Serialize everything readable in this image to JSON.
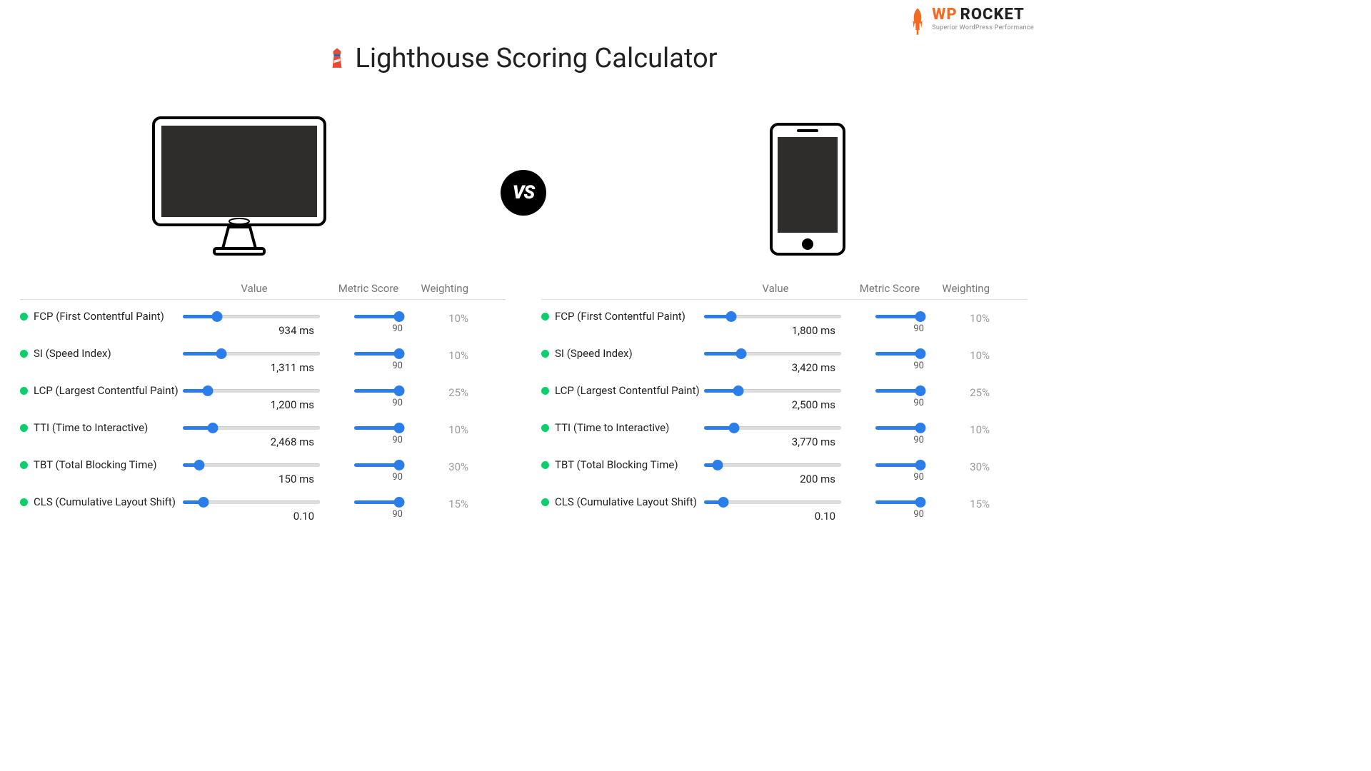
{
  "brand": {
    "wp": "WP",
    "rocket": "ROCKET",
    "tagline": "Superior WordPress Performance"
  },
  "title": "Lighthouse Scoring Calculator",
  "vs": "VS",
  "columns": {
    "value": "Value",
    "metric_score": "Metric Score",
    "weighting": "Weighting"
  },
  "desktop": {
    "metrics": [
      {
        "label": "FCP (First Contentful Paint)",
        "value_text": "934 ms",
        "value_pos": 25,
        "score": "90",
        "score_pos": 90,
        "weight": "10%"
      },
      {
        "label": "SI (Speed Index)",
        "value_text": "1,311 ms",
        "value_pos": 28,
        "score": "90",
        "score_pos": 90,
        "weight": "10%"
      },
      {
        "label": "LCP (Largest Contentful Paint)",
        "value_text": "1,200 ms",
        "value_pos": 18,
        "score": "90",
        "score_pos": 90,
        "weight": "25%"
      },
      {
        "label": "TTI (Time to Interactive)",
        "value_text": "2,468 ms",
        "value_pos": 22,
        "score": "90",
        "score_pos": 90,
        "weight": "10%"
      },
      {
        "label": "TBT (Total Blocking Time)",
        "value_text": "150 ms",
        "value_pos": 12,
        "score": "90",
        "score_pos": 90,
        "weight": "30%"
      },
      {
        "label": "CLS (Cumulative Layout Shift)",
        "value_text": "0.10",
        "value_pos": 15,
        "score": "90",
        "score_pos": 90,
        "weight": "15%"
      }
    ]
  },
  "mobile": {
    "metrics": [
      {
        "label": "FCP (First Contentful Paint)",
        "value_text": "1,800 ms",
        "value_pos": 20,
        "score": "90",
        "score_pos": 90,
        "weight": "10%"
      },
      {
        "label": "SI (Speed Index)",
        "value_text": "3,420 ms",
        "value_pos": 27,
        "score": "90",
        "score_pos": 90,
        "weight": "10%"
      },
      {
        "label": "LCP (Largest Contentful Paint)",
        "value_text": "2,500 ms",
        "value_pos": 25,
        "score": "90",
        "score_pos": 90,
        "weight": "25%"
      },
      {
        "label": "TTI (Time to Interactive)",
        "value_text": "3,770 ms",
        "value_pos": 22,
        "score": "90",
        "score_pos": 90,
        "weight": "10%"
      },
      {
        "label": "TBT (Total Blocking Time)",
        "value_text": "200 ms",
        "value_pos": 10,
        "score": "90",
        "score_pos": 90,
        "weight": "30%"
      },
      {
        "label": "CLS (Cumulative Layout Shift)",
        "value_text": "0.10",
        "value_pos": 14,
        "score": "90",
        "score_pos": 90,
        "weight": "15%"
      }
    ]
  }
}
